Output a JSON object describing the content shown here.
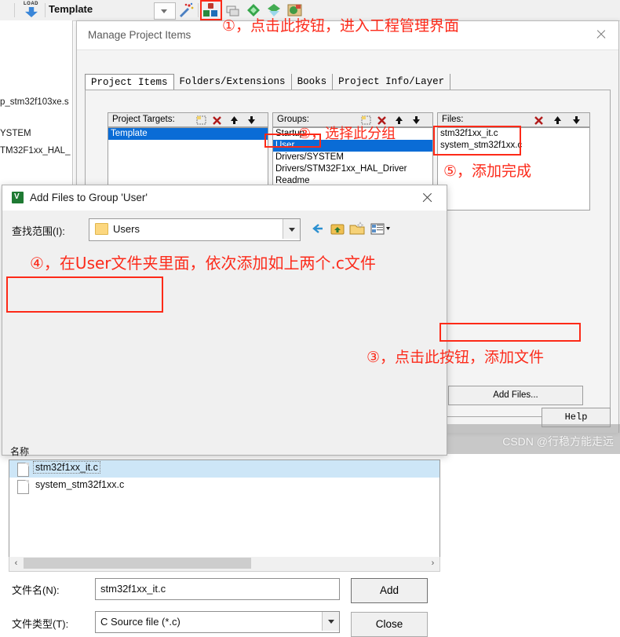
{
  "ide": {
    "toolbar": {
      "load_label": "LOAD",
      "target_name": "Template",
      "icons": [
        "load-icon",
        "target-combo",
        "wand-icon",
        "manage-project-items-icon",
        "batch-build-icon",
        "configuration-wizard-icon",
        "pack-installer-icon",
        "manage-run-time-icon"
      ]
    },
    "project_tree": [
      "p_stm32f103xe.s",
      "YSTEM",
      "TM32F1xx_HAL_"
    ]
  },
  "manage_dialog": {
    "title": "Manage Project Items",
    "tabs": [
      {
        "label": "Project Items",
        "active": true
      },
      {
        "label": "Folders/Extensions",
        "active": false
      },
      {
        "label": "Books",
        "active": false
      },
      {
        "label": "Project Info/Layer",
        "active": false
      }
    ],
    "project_targets": {
      "header": "Project Targets:",
      "items": [
        {
          "label": "Template",
          "selected": true
        }
      ]
    },
    "groups": {
      "header": "Groups:",
      "items": [
        {
          "label": "Startup",
          "selected": false
        },
        {
          "label": "User",
          "selected": true
        },
        {
          "label": "Drivers/SYSTEM",
          "selected": false
        },
        {
          "label": "Drivers/STM32F1xx_HAL_Driver",
          "selected": false
        },
        {
          "label": "Readme",
          "selected": false
        }
      ]
    },
    "files": {
      "header": "Files:",
      "items": [
        {
          "label": "stm32f1xx_it.c",
          "selected": false
        },
        {
          "label": "system_stm32f1xx.c",
          "selected": false
        }
      ]
    },
    "add_files_label": "Add Files...",
    "help_label": "Help"
  },
  "add_files_dialog": {
    "title": "Add Files to Group 'User'",
    "look_in_label": "查找范围(I):",
    "look_in_value": "Users",
    "nav_icons": [
      "back-icon",
      "up-one-level-icon",
      "new-folder-icon",
      "views-icon"
    ],
    "name_column_label": "名称",
    "files": [
      {
        "label": "stm32f1xx_it.c",
        "selected": true
      },
      {
        "label": "system_stm32f1xx.c",
        "selected": false
      }
    ],
    "filename_label": "文件名(N):",
    "filename_value": "stm32f1xx_it.c",
    "filetype_label": "文件类型(T):",
    "filetype_value": "C Source file (*.c)",
    "add_label": "Add",
    "close_label": "Close"
  },
  "annotations": {
    "a1": "①，点击此按钮，进入工程管理界面",
    "a2": "②，选择此分组",
    "a3": "③，点击此按钮，添加文件",
    "a4": "④，在User文件夹里面，依次添加如上两个.c文件",
    "a5": "⑤，添加完成",
    "color": "#fd2a18"
  },
  "watermark": "CSDN @行稳方能走远"
}
